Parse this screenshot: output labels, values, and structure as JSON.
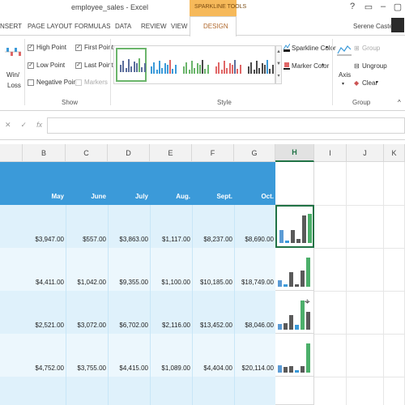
{
  "window": {
    "title": "employee_sales - Excel",
    "context_tab_label": "SPARKLINE TOOLS",
    "user": "Serene Caster",
    "help_icon": "?",
    "minimize_icon": "–",
    "restore_icon": "▢"
  },
  "tabs": [
    "NSERT",
    "PAGE LAYOUT",
    "FORMULAS",
    "DATA",
    "REVIEW",
    "VIEW",
    "DESIGN"
  ],
  "ribbon": {
    "winloss_label_1": "Win/",
    "winloss_label_2": "Loss",
    "show_group": {
      "label": "Show",
      "items": [
        {
          "label": "High Point",
          "checked": true
        },
        {
          "label": "Low Point",
          "checked": true
        },
        {
          "label": "Negative Points",
          "checked": false
        },
        {
          "label": "First Point",
          "checked": true
        },
        {
          "label": "Last Point",
          "checked": true
        },
        {
          "label": "Markers",
          "checked": false,
          "disabled": true
        }
      ]
    },
    "style_group": {
      "label": "Style",
      "sparkline_color": "Sparkline Color",
      "marker_color": "Marker Color",
      "accent_colors": [
        "#5b6e9c",
        "#3b9ad9",
        "#6bb56b",
        "#e06666",
        "#4a4a4a"
      ]
    },
    "group_group": {
      "label": "Group",
      "axis": "Axis",
      "group": "Group",
      "ungroup": "Ungroup",
      "clear": "Clear"
    }
  },
  "formula_bar": {
    "cancel_icon": "✕",
    "enter_icon": "✓",
    "fx_icon": "fx",
    "value": ""
  },
  "columns": [
    "B",
    "C",
    "D",
    "E",
    "F",
    "G",
    "H",
    "I",
    "J",
    "K"
  ],
  "months": [
    "May",
    "June",
    "July",
    "Aug.",
    "Sept.",
    "Oct."
  ],
  "rows": [
    {
      "values": [
        "$3,947.00",
        "$557.00",
        "$3,863.00",
        "$1,117.00",
        "$8,237.00",
        "$8,690.00"
      ],
      "sparkline": [
        3947,
        557,
        3863,
        1117,
        8237,
        8690
      ]
    },
    {
      "values": [
        "$4,411.00",
        "$1,042.00",
        "$9,355.00",
        "$1,100.00",
        "$10,185.00",
        "$18,749.00"
      ],
      "sparkline": [
        4411,
        1042,
        9355,
        1100,
        10185,
        18749
      ]
    },
    {
      "values": [
        "$2,521.00",
        "$3,072.00",
        "$6,702.00",
        "$2,116.00",
        "$13,452.00",
        "$8,046.00"
      ],
      "sparkline": [
        2521,
        3072,
        6702,
        2116,
        13452,
        8046
      ]
    },
    {
      "values": [
        "$4,752.00",
        "$3,755.00",
        "$4,415.00",
        "$1,089.00",
        "$4,404.00",
        "$20,114.00"
      ],
      "sparkline": [
        4752,
        3755,
        4415,
        1089,
        4404,
        20114
      ]
    }
  ],
  "colors": {
    "header_band": "#3b9ad9",
    "row_band_light": "#dff1fb",
    "row_band_lighter": "#ecf7fd",
    "spark_high": "#4caf6a",
    "spark_low": "#3b9ad9",
    "spark_first": "#5b9bd5",
    "spark_normal": "#5a5a5a",
    "accent_green": "#217346"
  }
}
